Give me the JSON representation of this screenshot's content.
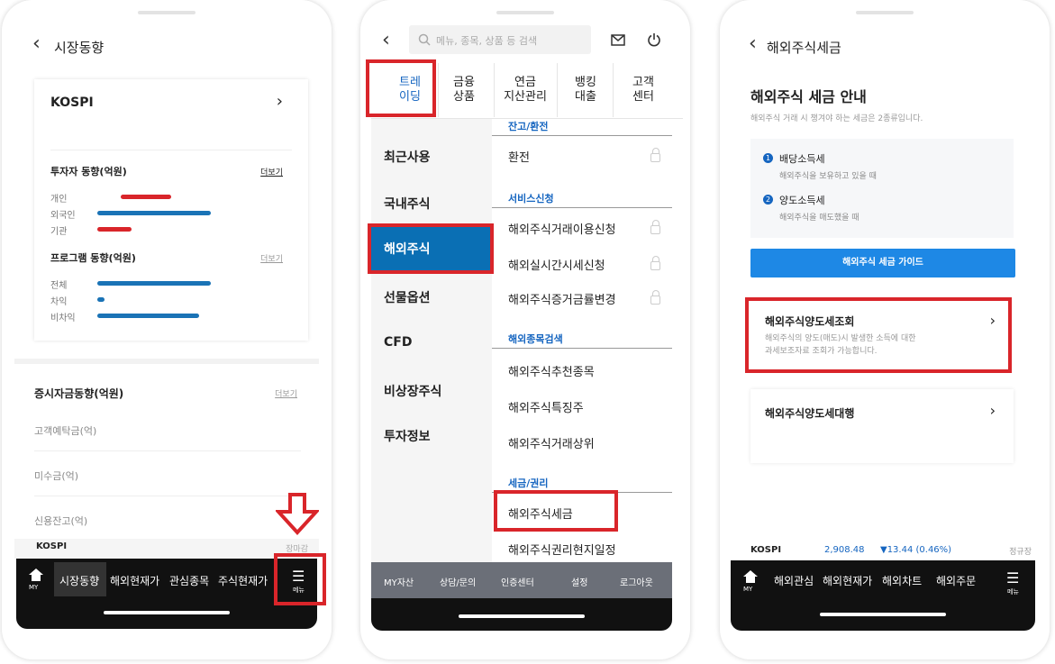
{
  "p1": {
    "title": "시장동향",
    "card_title": "KOSPI",
    "investor_title": "투자자 동향(억원)",
    "more": "더보기",
    "investors": [
      "개인",
      "외국인",
      "기관"
    ],
    "program_title": "프로그램 동향(억원)",
    "programs": [
      "전체",
      "차익",
      "비차익"
    ],
    "deposit_title": "증시자금동향(억원)",
    "deposit_rows": [
      "고객예탁금(억)",
      "미수금(억)",
      "신용잔고(억)"
    ],
    "ticker": "KOSPI",
    "ticker_right": "장마감",
    "nav_home": "MY",
    "nav_items": [
      "시장동향",
      "해외현재가",
      "관심종목",
      "주식현재가"
    ],
    "nav_menu": "메뉴"
  },
  "p2": {
    "search_placeholder": "메뉴, 종목, 상품 등 검색",
    "tabs": [
      "트레\n이딩",
      "금융\n상품",
      "연금\n지산관리",
      "뱅킹\n대출",
      "고객\n센터"
    ],
    "left_menu": [
      "최근사용",
      "국내주식",
      "해외주식",
      "선물옵션",
      "CFD",
      "비상장주식",
      "투자정보"
    ],
    "sections": [
      {
        "title": "잔고/환전",
        "items": [
          "환전"
        ]
      },
      {
        "title": "서비스신청",
        "items": [
          "해외주식거래이용신청",
          "해외실시간시세신청",
          "해외주식증거금률변경"
        ]
      },
      {
        "title": "해외종목검색",
        "items": [
          "해외주식추천종목",
          "해외주식특징주",
          "해외주식거래상위"
        ]
      },
      {
        "title": "세금/권리",
        "items": [
          "해외주식세금",
          "해외주식권리현지일정"
        ]
      }
    ],
    "bottom": [
      "MY자산",
      "상담/문의",
      "인증센터",
      "설정",
      "로그아웃"
    ]
  },
  "p3": {
    "title": "해외주식세금",
    "heading": "해외주식 세금 안내",
    "sub": "해외주식 거래 시 챙겨야 하는 세금은 2종류입니다.",
    "tax1_num": "1",
    "tax1_title": "배당소득세",
    "tax1_desc": "해외주식을 보유하고 있을 때",
    "tax2_num": "2",
    "tax2_title": "양도소득세",
    "tax2_desc": "해외주식을 매도했을 때",
    "guide_button": "해외주식 세금 가이드",
    "query_title": "해외주식양도세조회",
    "query_desc1": "해외주식의 양도(매도)시 발생한 소득에 대한",
    "query_desc2": "과세보조자료 조회가 가능합니다.",
    "agent_title": "해외주식양도세대행",
    "ticker_name": "KOSPI",
    "ticker_value": "2,908.48",
    "ticker_change": "▼13.44 (0.46%)",
    "ticker_right": "정규장",
    "nav_home": "MY",
    "nav_items": [
      "해외관심",
      "해외현재가",
      "해외차트",
      "해외주문"
    ],
    "nav_menu": "메뉴"
  },
  "colors": {
    "accent_red": "#d9252a",
    "blue_bar": "#1a73b6",
    "red_bar": "#d9252a",
    "guide_blue": "#1e88e5",
    "nav_dark": "#111111"
  },
  "investor_values": [
    0.58,
    1.0,
    0.3
  ],
  "program_values": [
    1.0,
    0.06,
    0.9
  ]
}
